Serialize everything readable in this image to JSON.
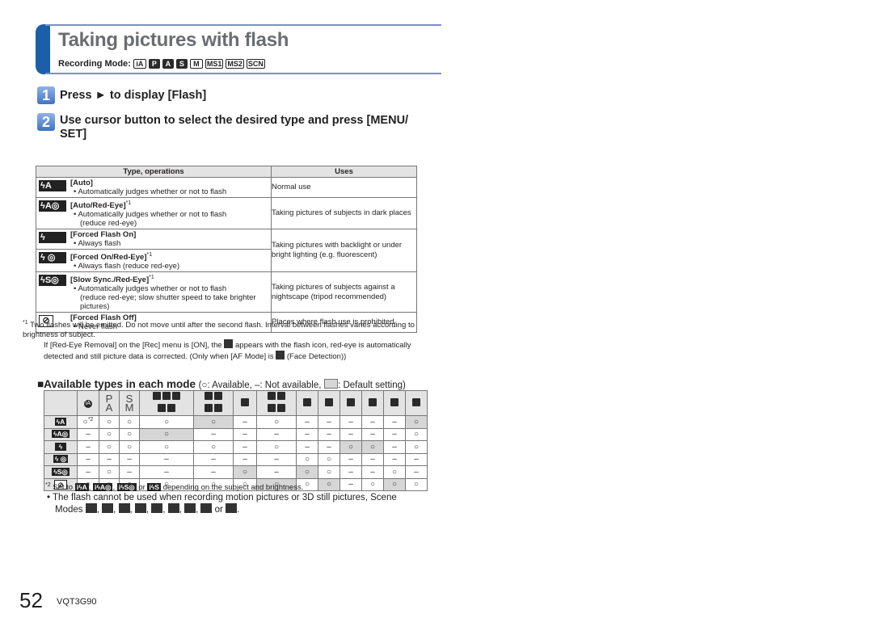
{
  "header": {
    "title": "Taking pictures with flash",
    "recording_mode_label": "Recording Mode:",
    "recording_modes": [
      "iA",
      "P",
      "A",
      "S",
      "M",
      "MS1",
      "MS2",
      "SCN"
    ]
  },
  "steps": [
    {
      "number": "1",
      "text": "Press ► to display [Flash]"
    },
    {
      "number": "2",
      "text": "Use cursor button to select the desired type and press [MENU/ SET]"
    }
  ],
  "flash_table": {
    "headers": [
      "Type, operations",
      "Uses"
    ],
    "rows": [
      {
        "icon": "ϟA",
        "name": "[Auto]",
        "bullet": "• Automatically judges whether or not to flash",
        "cont": "",
        "note": "",
        "uses": "Normal use"
      },
      {
        "icon": "ϟA◎",
        "name": "[Auto/Red-Eye]",
        "note": "*1",
        "bullet": "• Automatically judges whether or not to flash",
        "cont": "(reduce red-eye)",
        "uses": "Taking pictures of subjects in dark places"
      },
      {
        "icon": "ϟ",
        "name": "[Forced Flash On]",
        "note": "",
        "bullet": "• Always flash",
        "cont": "",
        "uses": "Taking pictures with backlight or under bright lighting (e.g. fluorescent)"
      },
      {
        "icon": "ϟ ◎",
        "name": "[Forced On/Red-Eye]",
        "note": "*1",
        "bullet": "• Always flash (reduce red-eye)",
        "cont": "",
        "uses": ""
      },
      {
        "icon": "ϟS◎",
        "name": "[Slow Sync./Red-Eye]",
        "note": "*1",
        "bullet": "• Automatically judges whether or not to flash",
        "cont": "(reduce red-eye; slow shutter speed to take brighter pictures)",
        "uses": "Taking pictures of subjects against a nightscape (tripod recommended)"
      },
      {
        "icon": "⊘",
        "name": "[Forced Flash Off]",
        "note": "",
        "bullet": "• Never flash",
        "cont": "",
        "uses": "Places where flash use is prohibited"
      }
    ]
  },
  "footnote1": {
    "marker": "*1",
    "line1": "Two flashes will be emitted. Do not move until after the second flash. Interval between flashes varies according to brightness of subject.",
    "line2a": "If [Red-Eye Removal] on the [Rec] menu is [ON], the",
    "line2b": "appears with the flash icon, red-eye is automatically detected and still picture data is corrected. (Only when [AF Mode] is",
    "line2c": "(Face Detection))"
  },
  "availability": {
    "title": "■Available types in each mode",
    "legend_a": "(○: Available, –: Not available,",
    "legend_b": ": Default setting)",
    "columns": [
      "iA",
      "P/A",
      "S/M",
      "Portrait group",
      "Scenery group",
      "Sports",
      "Food/Pet group",
      "Party",
      "Candle",
      "Baby",
      "Sunset",
      "Photo frame",
      "Last mode"
    ],
    "row_icons": [
      "ϟA",
      "ϟA◎",
      "ϟ",
      "ϟ ◎",
      "ϟS◎",
      "⊘"
    ],
    "rows": [
      [
        "o*2",
        "o",
        "o",
        "o",
        "o",
        "-",
        "o",
        "-",
        "-",
        "-",
        "-",
        "-",
        "o"
      ],
      [
        "-",
        "o",
        "o",
        "o",
        "-",
        "-",
        "-",
        "-",
        "-",
        "-",
        "-",
        "-",
        "o"
      ],
      [
        "-",
        "o",
        "o",
        "o",
        "o",
        "-",
        "o",
        "-",
        "-",
        "o",
        "o",
        "-",
        "o"
      ],
      [
        "-",
        "-",
        "-",
        "-",
        "-",
        "-",
        "-",
        "o",
        "o",
        "-",
        "-",
        "-",
        "-"
      ],
      [
        "-",
        "o",
        "-",
        "-",
        "-",
        "o",
        "-",
        "o",
        "o",
        "-",
        "-",
        "o",
        "-"
      ],
      [
        "o",
        "o",
        "o",
        "o",
        "o",
        "o",
        "o",
        "o",
        "o",
        "-",
        "o",
        "o",
        "o"
      ]
    ],
    "defaults": [
      [
        4,
        12
      ],
      [
        3
      ],
      [
        9,
        10
      ],
      [],
      [
        5,
        7
      ],
      [
        6,
        8,
        11
      ]
    ]
  },
  "footnote2": {
    "marker": "*2",
    "text_a": "Set to",
    "icons": [
      "iϟA",
      "iϟA◎",
      "iϟS◎",
      "iϟS"
    ],
    "sep_or": "or",
    "text_b": "depending on the subject and brightness."
  },
  "note": {
    "line1": "• The flash cannot be used when recording motion pictures or 3D still pictures, Scene",
    "line2": "Modes",
    "scene_icons": [
      "scenery",
      "panorama",
      "night-scenery",
      "night-portrait",
      "sunset",
      "starry-sky",
      "fireworks",
      "through-glass",
      "hdr"
    ],
    "or": "or"
  },
  "footer": {
    "page_number": "52",
    "code": "VQT3G90"
  }
}
